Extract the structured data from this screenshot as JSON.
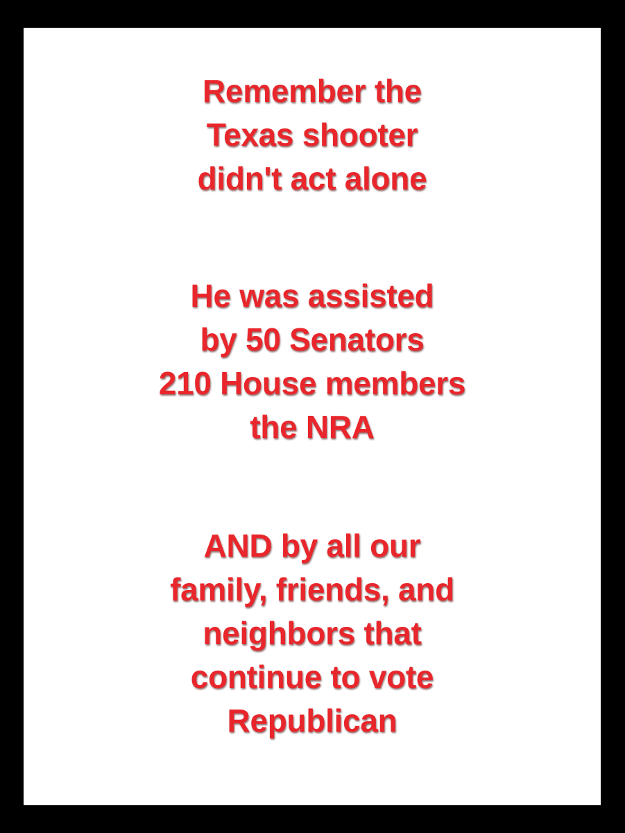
{
  "colors": {
    "background_border": "#000000",
    "panel": "#ffffff",
    "text": "#e8262b"
  },
  "paragraphs": [
    {
      "lines": [
        "Remember the",
        "Texas shooter",
        "didn't act alone"
      ]
    },
    {
      "lines": [
        "He was assisted",
        "by 50 Senators",
        "210 House members",
        "the NRA"
      ]
    },
    {
      "lines": [
        "AND by all our",
        "family, friends, and",
        "neighbors that",
        "continue to vote",
        "Republican"
      ]
    }
  ]
}
